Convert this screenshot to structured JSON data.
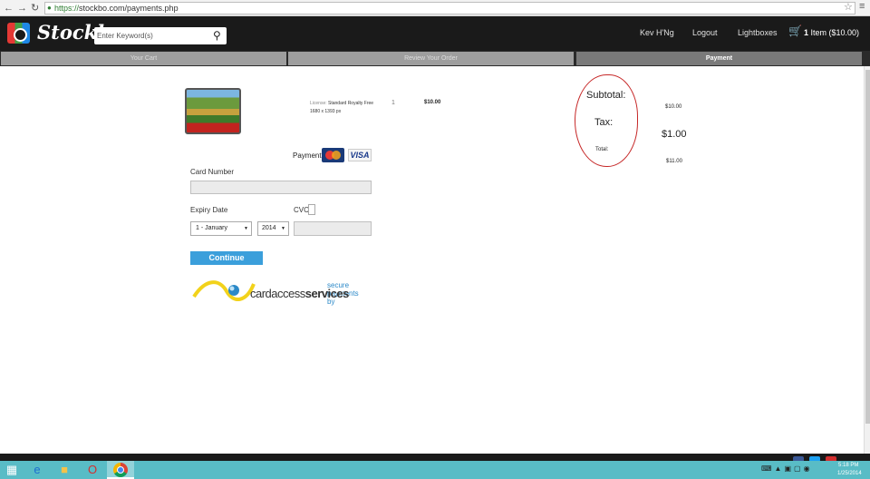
{
  "browser": {
    "url_scheme": "https://",
    "url_rest": "stockbo.com/payments.php",
    "back_icon": "arrow-left-icon",
    "forward_icon": "arrow-right-icon",
    "reload_icon": "reload-icon"
  },
  "header": {
    "logo_text": "Stockbo",
    "search_placeholder": "Enter Keyword(s)",
    "user_name": "Kev H'Ng",
    "logout_label": "Logout",
    "lightboxes_label": "Lightboxes",
    "cart_count": "1",
    "cart_text": "Item ($10.00)"
  },
  "steps": [
    {
      "label": "Your Cart",
      "active": false
    },
    {
      "label": "Review Your Order",
      "active": false
    },
    {
      "label": "Payment",
      "active": true
    }
  ],
  "order_item": {
    "license_label": "License:",
    "license_value": "Standard Royalty Free",
    "dimensions": "1680 x 1393 px",
    "quantity": "1",
    "price": "$10.00"
  },
  "payment": {
    "payment_label": "Payment",
    "card_brands": [
      "MasterCard",
      "VISA"
    ],
    "card_number_label": "Card Number",
    "expiry_label": "Expiry Date",
    "cvc_label": "CVC",
    "month_value": "1 - January",
    "year_value": "2014",
    "continue_label": "Continue",
    "processor_tagline": "secure payments by",
    "processor_name_a": "cardaccess",
    "processor_name_b": "services"
  },
  "summary": {
    "subtotal_label": "Subtotal:",
    "subtotal_value": "$10.00",
    "tax_label": "Tax:",
    "tax_value": "$1.00",
    "total_label": "Total:",
    "total_value": "$11.00",
    "annotation_color": "#c62828"
  },
  "colors": {
    "header_bg": "#1a1a1a",
    "continue_bg": "#3b9fdb",
    "taskbar_bg": "#59bcc6"
  },
  "taskbar": {
    "time": "5:18 PM",
    "date": "1/25/2014"
  }
}
